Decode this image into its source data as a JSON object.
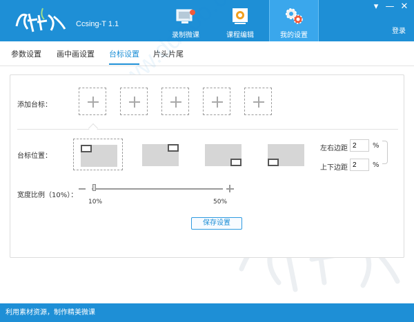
{
  "app": {
    "title": "Ccsing-T 1.1"
  },
  "nav": {
    "items": [
      {
        "label": "录制微课",
        "icon": "record-icon"
      },
      {
        "label": "课程编辑",
        "icon": "edit-icon"
      },
      {
        "label": "我的设置",
        "icon": "settings-icon",
        "active": true
      }
    ],
    "login_label": "登录"
  },
  "window": {
    "menu_glyph": "▾",
    "minimize_glyph": "—",
    "close_glyph": "✕"
  },
  "tabs": [
    {
      "label": "参数设置"
    },
    {
      "label": "画中画设置"
    },
    {
      "label": "台标设置",
      "active": true
    },
    {
      "label": "片头片尾"
    }
  ],
  "logo_settings": {
    "add_label": "添加台标：",
    "position_label": "台标位置：",
    "positions": [
      "top-left",
      "top-right",
      "bottom-right",
      "bottom-left"
    ],
    "selected_position": "top-left",
    "margin_lr_label": "左右边距",
    "margin_lr_value": "2",
    "margin_tb_label": "上下边距",
    "margin_tb_value": "2",
    "percent_unit": "%",
    "width_ratio_label": "宽度比例（10%）：",
    "slider_min_label": "10%",
    "slider_max_label": "50%",
    "slider_value": 10,
    "save_label": "保存设置"
  },
  "status": {
    "text": "利用素材资源，制作精美微课"
  },
  "watermark": {
    "text": "www.ddooo.com"
  },
  "colors": {
    "header_blue": "#1e8fd6",
    "active_nav": "#3aa7ec"
  }
}
